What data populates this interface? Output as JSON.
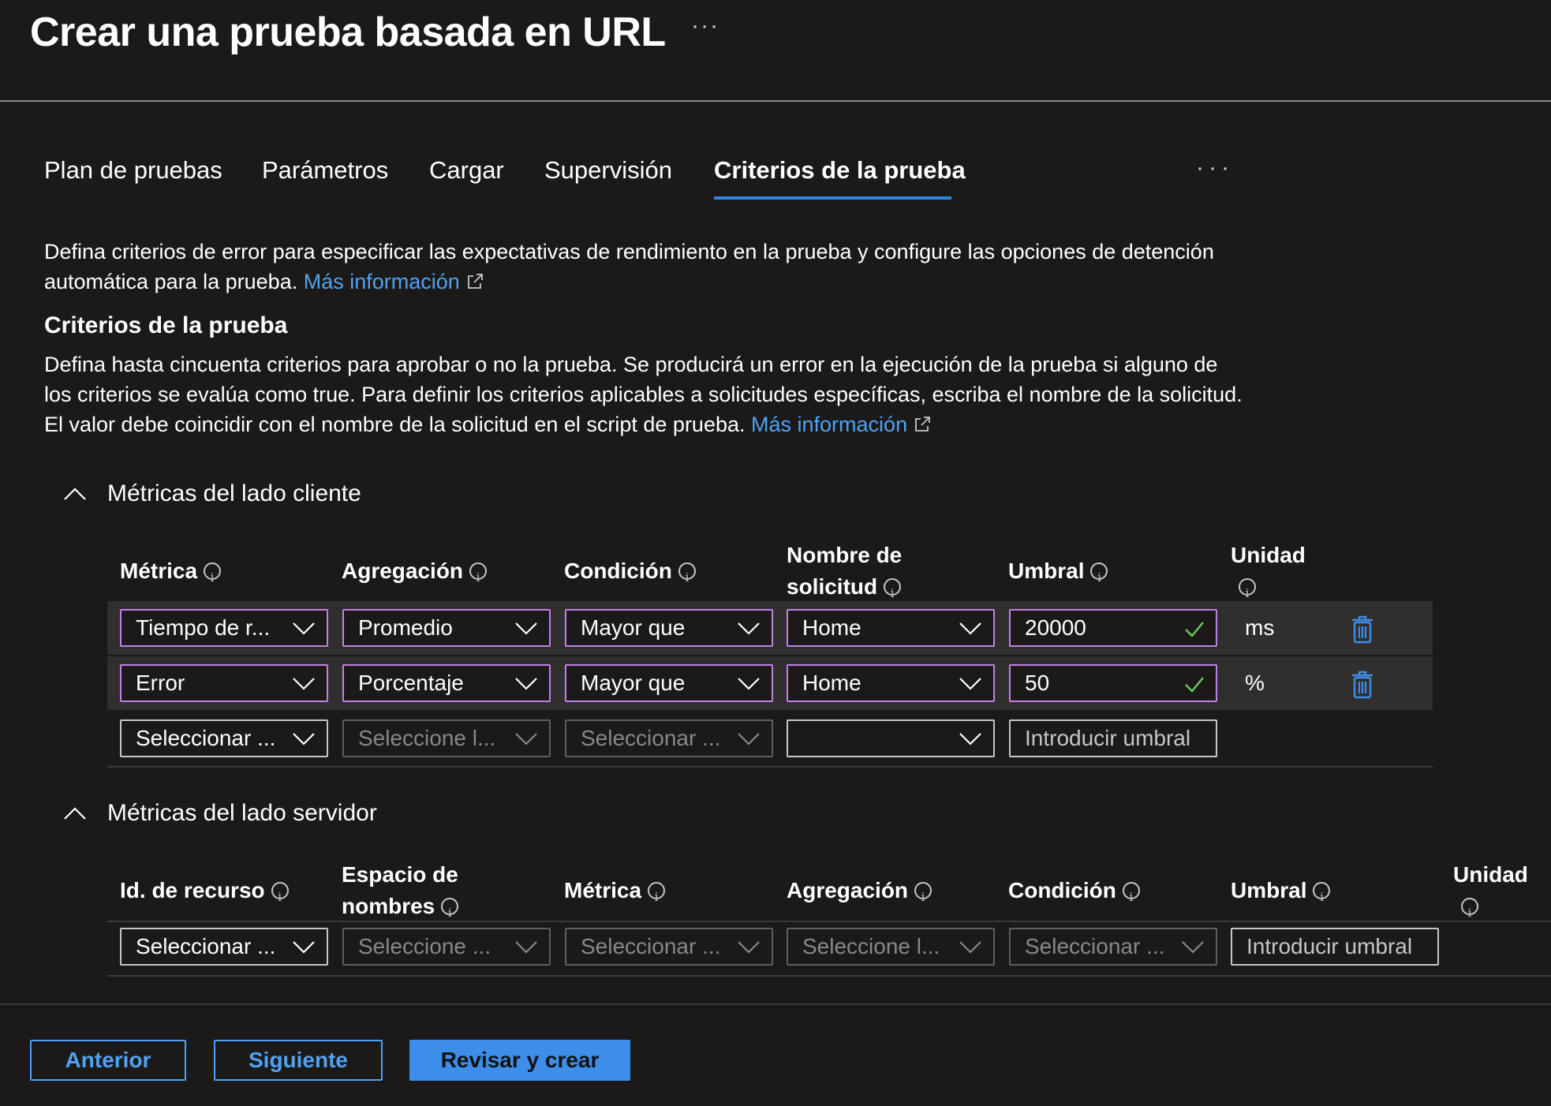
{
  "page": {
    "title": "Crear una prueba basada en URL",
    "title_more": "···"
  },
  "tabs": [
    {
      "label": "Plan de pruebas"
    },
    {
      "label": "Parámetros"
    },
    {
      "label": "Cargar"
    },
    {
      "label": "Supervisión"
    },
    {
      "label": "Criterios de la prueba",
      "active": true
    }
  ],
  "tabs_more": "···",
  "intro": {
    "text": "Defina criterios de error para especificar las expectativas de rendimiento en la prueba y configure las opciones de detención automática para la prueba.",
    "link": "Más información"
  },
  "criteria": {
    "heading": "Criterios de la prueba",
    "text": "Defina hasta cincuenta criterios para aprobar o no la prueba. Se producirá un error en la ejecución de la prueba si alguno de los criterios se evalúa como true. Para definir los criterios aplicables a solicitudes específicas, escriba el nombre de la solicitud. El valor debe coincidir con el nombre de la solicitud en el script de prueba.",
    "link": "Más información"
  },
  "client": {
    "section_title": "Métricas del lado cliente",
    "headers": {
      "metric": "Métrica",
      "aggregation": "Agregación",
      "condition": "Condición",
      "request_name_1": "Nombre de",
      "request_name_2": "solicitud",
      "threshold": "Umbral",
      "unit": "Unidad"
    },
    "rows": [
      {
        "metric": "Tiempo de r...",
        "aggregation": "Promedio",
        "condition": "Mayor que",
        "request": "Home",
        "threshold": "20000",
        "unit": "ms"
      },
      {
        "metric": "Error",
        "aggregation": "Porcentaje",
        "condition": "Mayor que",
        "request": "Home",
        "threshold": "50",
        "unit": "%"
      }
    ],
    "new_row": {
      "metric": "Seleccionar ...",
      "aggregation": "Seleccione l...",
      "condition": "Seleccionar ...",
      "request": "",
      "threshold_placeholder": "Introducir umbral"
    }
  },
  "server": {
    "section_title": "Métricas del lado servidor",
    "headers": {
      "resource": "Id. de recurso",
      "namespace_1": "Espacio de",
      "namespace_2": "nombres",
      "metric": "Métrica",
      "aggregation": "Agregación",
      "condition": "Condición",
      "threshold": "Umbral",
      "unit": "Unidad"
    },
    "new_row": {
      "resource": "Seleccionar ...",
      "namespace": "Seleccione ...",
      "metric": "Seleccionar ...",
      "aggregation": "Seleccione l...",
      "condition": "Seleccionar ...",
      "threshold_placeholder": "Introducir umbral"
    }
  },
  "footer": {
    "prev": "Anterior",
    "next": "Siguiente",
    "review": "Revisar y crear"
  },
  "colors": {
    "background": "#1b1a19",
    "accent": "#2f86e0",
    "link": "#4ea3f5",
    "focus_border": "#c27fe8",
    "success": "#6ccb5f"
  }
}
